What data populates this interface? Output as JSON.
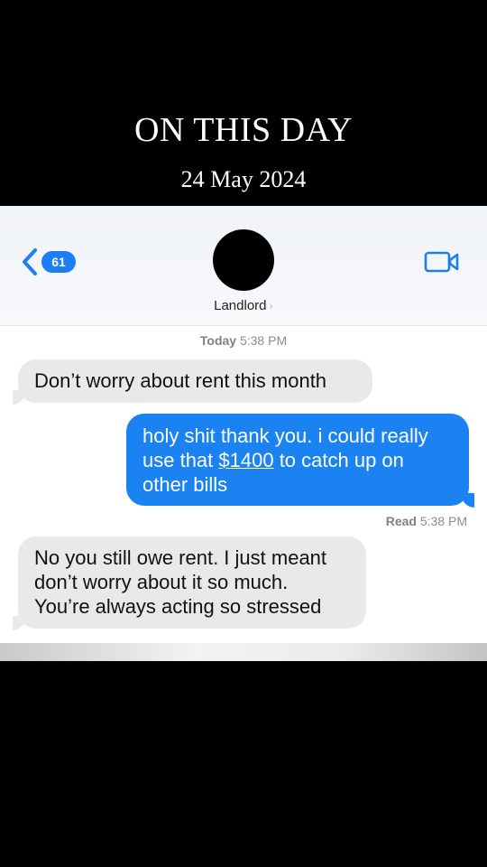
{
  "banner": {
    "title": "ON THIS DAY",
    "date": "24 May 2024"
  },
  "header": {
    "back_badge": "61",
    "back_icon": "chevron-left-icon",
    "contact_name": "Landlord",
    "contact_chevron": "›",
    "video_icon": "video-camera-icon"
  },
  "thread": {
    "timestamp_day": "Today",
    "timestamp_time": "5:38 PM",
    "messages": [
      {
        "direction": "received",
        "text": "Don’t worry about rent this month"
      },
      {
        "direction": "sent",
        "line1": "holy shit thank you. i could really",
        "line2_pre": "use that ",
        "line2_link": "$1400",
        "line2_post": " to catch up on",
        "line3": "other bills"
      },
      {
        "direction": "received",
        "line1": "No you still owe rent. I just meant",
        "line2": "don’t worry about it so much.",
        "line3": "You’re always acting so stressed"
      }
    ],
    "read_label": "Read",
    "read_time": "5:38 PM"
  },
  "colors": {
    "accent": "#1b82f1",
    "received_bubble": "#e9e9eb",
    "banner_bg": "#000000"
  }
}
